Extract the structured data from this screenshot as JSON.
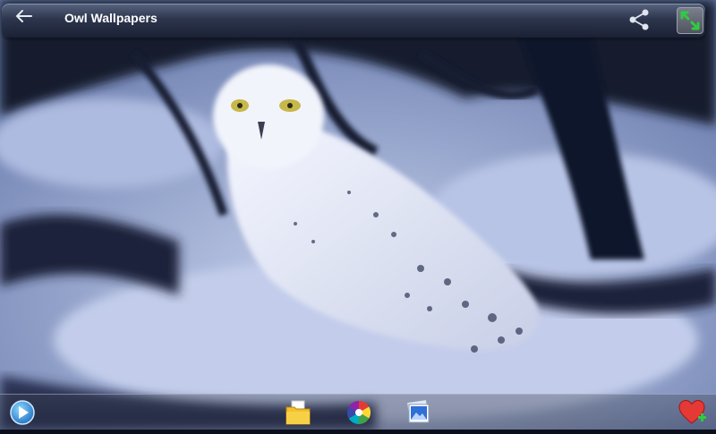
{
  "header": {
    "title": "Owl Wallpapers"
  },
  "icons": {
    "back": "arrow-left-icon",
    "share": "share-icon",
    "fullscreen": "expand-icon",
    "play": "play-icon",
    "folder": "folder-icon",
    "color_wheel": "color-wheel-icon",
    "picture": "picture-icon",
    "favorite": "heart-plus-icon"
  },
  "colors": {
    "accent_green": "#2ecc40",
    "heart_red": "#e53935"
  }
}
